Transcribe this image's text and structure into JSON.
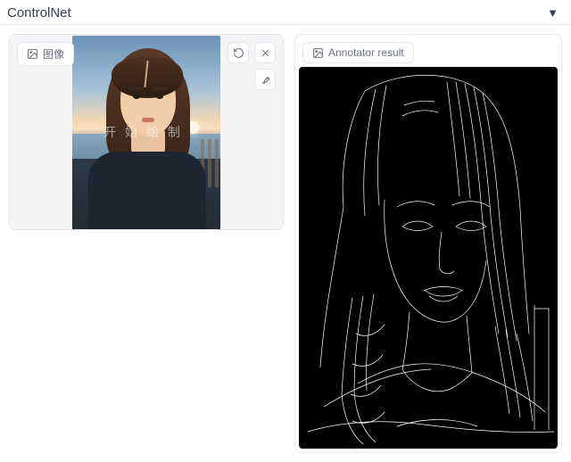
{
  "header": {
    "title": "ControlNet",
    "collapse_glyph": "▼"
  },
  "input_panel": {
    "label": "图像",
    "watermark": "开始绘制",
    "tools": {
      "undo": "undo-icon",
      "clear": "close-icon",
      "brush": "brush-icon"
    }
  },
  "output_panel": {
    "label": "Annotator result"
  }
}
